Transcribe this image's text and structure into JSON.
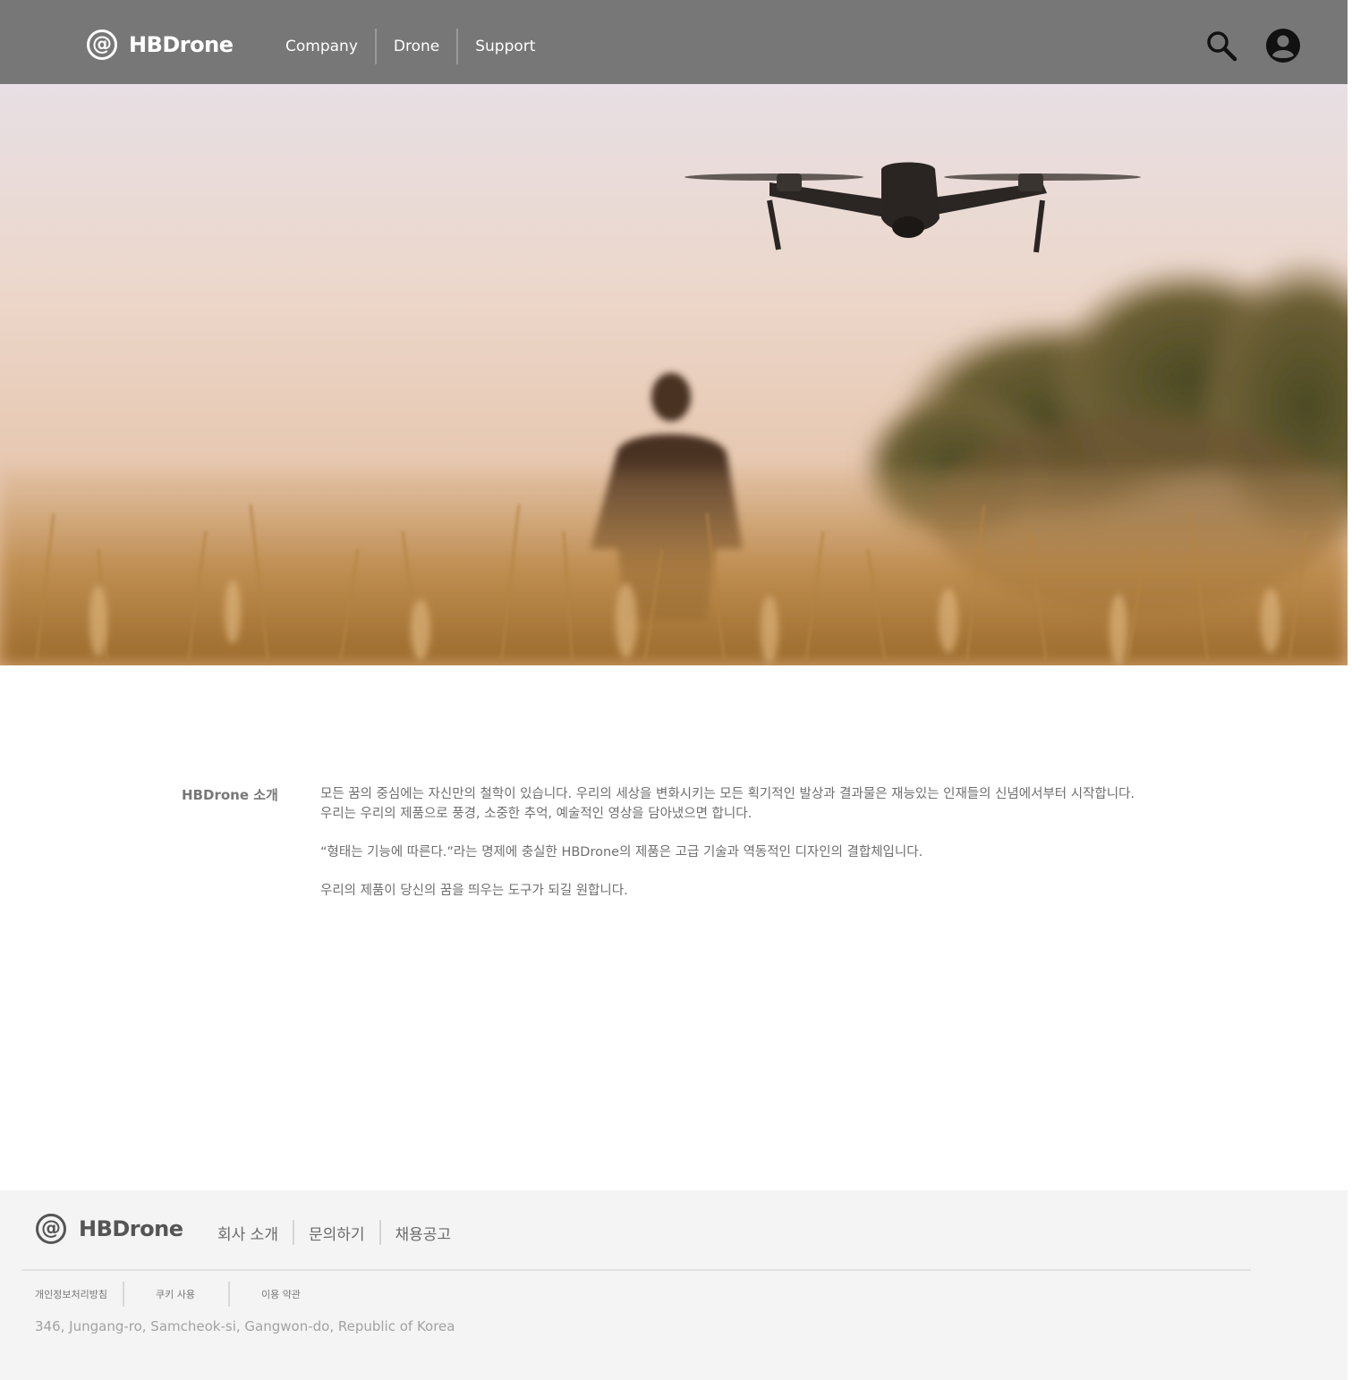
{
  "header": {
    "logo_mark": "@",
    "logo_text": "HBDrone",
    "nav": [
      "Company",
      "Drone",
      "Support"
    ],
    "icons": [
      "search-icon",
      "user-account-icon"
    ],
    "background": "#777777"
  },
  "hero": {
    "image": "drone-over-field-with-person-silhouette-at-sunset"
  },
  "intro": {
    "label": "HBDrone 소개",
    "paragraphs": [
      "모든 꿈의 중심에는 자신만의 철학이 있습니다. 우리의 세상을 변화시키는 모든 획기적인 발상과 결과물은 재능있는 인재들의 신념에서부터 시작합니다.",
      "우리는 우리의 제품으로 풍경, 소중한 추억, 예술적인 영상을 담아냈으면 합니다.",
      "“형태는 기능에 따른다.”라는 명제에 충실한 HBDrone의 제품은 고급 기술과 역동적인 디자인의 결합체입니다.",
      "우리의 제품이 당신의 꿈을 띄우는 도구가 되길 원합니다."
    ]
  },
  "footer": {
    "logo_mark": "@",
    "logo_text": "HBDrone",
    "nav": [
      "회사 소개",
      "문의하기",
      "채용공고"
    ],
    "links": [
      "개인정보처리방침",
      "쿠키 사용",
      "이용 약관"
    ],
    "address": "346, Jungang-ro, Samcheok-si, Gangwon-do, Republic of Korea",
    "background": "#f4f4f4"
  }
}
